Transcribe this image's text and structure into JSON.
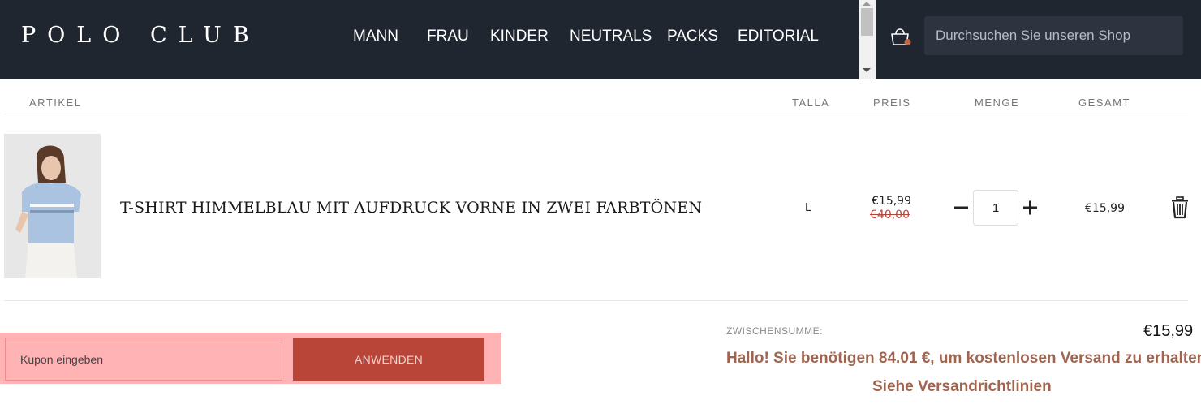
{
  "header": {
    "logo": "POLO CLUB",
    "nav": [
      "MANN",
      "FRAU",
      "KINDER",
      "NEUTRALS",
      "PACKS",
      "EDITORIAL"
    ],
    "search_placeholder": "Durchsuchen Sie unseren Shop",
    "cart_icon": "shopping-bag-icon"
  },
  "cart": {
    "columns": {
      "article": "ARTIKEL",
      "size": "TALLA",
      "price": "PREIS",
      "quantity": "MENGE",
      "total": "GESAMT"
    },
    "items": [
      {
        "name": "T-SHIRT HIMMELBLAU MIT AUFDRUCK VORNE IN ZWEI FARBTÖNEN",
        "size": "L",
        "price": "€15,99",
        "original_price": "€40,00",
        "quantity": "1",
        "total": "€15,99",
        "image_icon": "product-photo-woman-light-blue-tshirt"
      }
    ]
  },
  "coupon": {
    "placeholder": "Kupon eingeben",
    "apply_label": "ANWENDEN"
  },
  "summary": {
    "subtotal_label": "ZWISCHENSUMME:",
    "subtotal_value": "€15,99",
    "shipping_message": "Hallo! Sie benötigen 84.01 €, um kostenlosen Versand zu erhalten.",
    "shipping_link": "Siehe Versandrichtlinien"
  },
  "colors": {
    "header_bg": "#1f262f",
    "accent": "#b94538",
    "shipping_text": "#a0644f",
    "highlight": "#ffb3b5"
  }
}
